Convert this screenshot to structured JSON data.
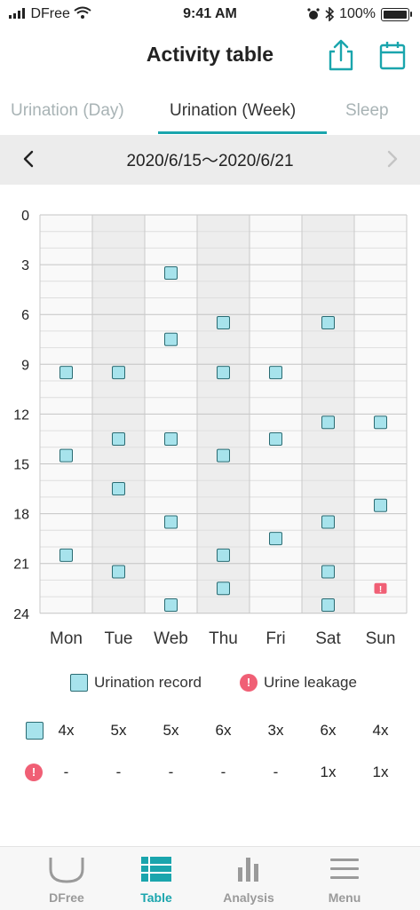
{
  "status": {
    "carrier": "DFree",
    "time": "9:41 AM",
    "battery": "100%"
  },
  "header": {
    "title": "Activity table"
  },
  "tabs": [
    {
      "label": "Urination (Day)",
      "active": false
    },
    {
      "label": "Urination (Week)",
      "active": true
    },
    {
      "label": "Sleep",
      "active": false
    }
  ],
  "date_range": "2020/6/15～2020/6/21",
  "colors": {
    "accent": "#1aa5ad",
    "record_fill": "#a7e3ec",
    "leak": "#f05f75"
  },
  "chart_data": {
    "type": "scatter",
    "y_ticks": [
      "0",
      "3",
      "6",
      "9",
      "12",
      "15",
      "18",
      "21",
      "24"
    ],
    "y_range": [
      0,
      24
    ],
    "days": [
      "Mon",
      "Tue",
      "Web",
      "Thu",
      "Fri",
      "Sat",
      "Sun"
    ],
    "urination_hours": [
      [
        9,
        14,
        20
      ],
      [
        9,
        13,
        16,
        21
      ],
      [
        3,
        7,
        13,
        18,
        23
      ],
      [
        6,
        9,
        14,
        20,
        22
      ],
      [
        9,
        13,
        19
      ],
      [
        6,
        12,
        18,
        21,
        23
      ],
      [
        12,
        17
      ]
    ],
    "leakage_hours": [
      [],
      [],
      [],
      [],
      [],
      [],
      [
        22
      ]
    ]
  },
  "legend": {
    "record": "Urination record",
    "leakage": "Urine leakage"
  },
  "summary": {
    "record_counts": [
      "4x",
      "5x",
      "5x",
      "6x",
      "3x",
      "6x",
      "4x"
    ],
    "leak_counts": [
      "-",
      "-",
      "-",
      "-",
      "-",
      "1x",
      "1x"
    ]
  },
  "bottom_nav": [
    {
      "label": "DFree",
      "icon": "dfree-icon"
    },
    {
      "label": "Table",
      "icon": "table-icon",
      "active": true
    },
    {
      "label": "Analysis",
      "icon": "bar-chart-icon"
    },
    {
      "label": "Menu",
      "icon": "menu-icon"
    }
  ]
}
